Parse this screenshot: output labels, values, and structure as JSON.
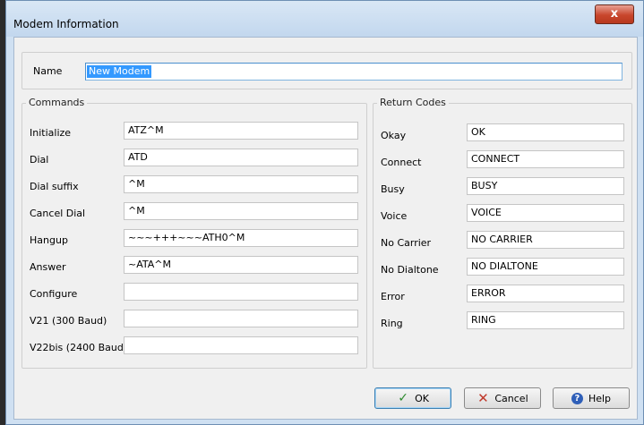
{
  "window": {
    "title": "Modem Information",
    "close_glyph": "x"
  },
  "name": {
    "label": "Name",
    "value": "New Modem"
  },
  "commands": {
    "title": "Commands",
    "rows": [
      {
        "label": "Initialize",
        "value": "ATZ^M"
      },
      {
        "label": "Dial",
        "value": "ATD"
      },
      {
        "label": "Dial suffix",
        "value": "^M"
      },
      {
        "label": "Cancel Dial",
        "value": "^M"
      },
      {
        "label": "Hangup",
        "value": "~~~+++~~~ATH0^M"
      },
      {
        "label": "Answer",
        "value": "~ATA^M"
      },
      {
        "label": "Configure",
        "value": ""
      },
      {
        "label": "V21 (300 Baud)",
        "value": ""
      },
      {
        "label": "V22bis (2400 Baud)",
        "value": ""
      }
    ]
  },
  "return_codes": {
    "title": "Return Codes",
    "rows": [
      {
        "label": "Okay",
        "value": "OK"
      },
      {
        "label": "Connect",
        "value": "CONNECT"
      },
      {
        "label": "Busy",
        "value": "BUSY"
      },
      {
        "label": "Voice",
        "value": "VOICE"
      },
      {
        "label": "No Carrier",
        "value": "NO CARRIER"
      },
      {
        "label": "No Dialtone",
        "value": "NO DIALTONE"
      },
      {
        "label": "Error",
        "value": "ERROR"
      },
      {
        "label": "Ring",
        "value": "RING"
      }
    ]
  },
  "buttons": {
    "ok": {
      "label": "OK",
      "icon": "check-icon"
    },
    "cancel": {
      "label": "Cancel",
      "icon": "x-icon"
    },
    "help": {
      "label": "Help",
      "icon": "help-icon"
    }
  }
}
